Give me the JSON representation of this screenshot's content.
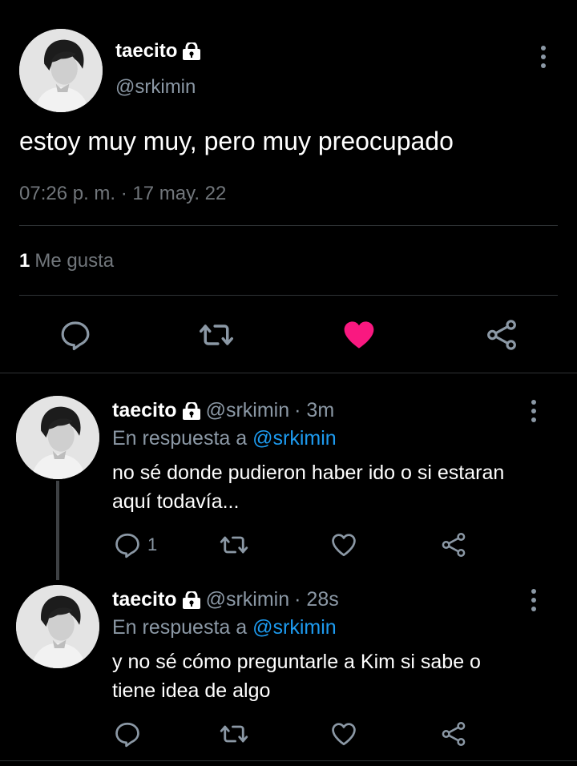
{
  "main_tweet": {
    "display_name": "taecito",
    "handle": "@srkimin",
    "text": "estoy muy muy, pero muy preocupado",
    "timestamp": "07:26 p. m. · 17 may. 22",
    "like_count": "1",
    "like_label": "Me gusta",
    "liked": true,
    "actions": [
      "reply-icon",
      "retweet-icon",
      "heart-filled-icon",
      "share-icon"
    ]
  },
  "replies": [
    {
      "display_name": "taecito",
      "handle": "@srkimin",
      "time": "· 3m",
      "replying_prefix": "En respuesta a",
      "replying_to": "@srkimin",
      "text": "no sé donde pudieron haber ido o si estaran aquí todavía...",
      "reply_count": "1"
    },
    {
      "display_name": "taecito",
      "handle": "@srkimin",
      "time": "· 28s",
      "replying_prefix": "En respuesta a",
      "replying_to": "@srkimin",
      "text": "y no sé cómo preguntarle a Kim si sabe o tiene idea de algo",
      "reply_count": ""
    }
  ],
  "colors": {
    "background": "#000000",
    "text": "#ffffff",
    "secondary": "#8b98a5",
    "link": "#1d9bf0",
    "like": "#f91880",
    "divider": "#2f3336"
  }
}
